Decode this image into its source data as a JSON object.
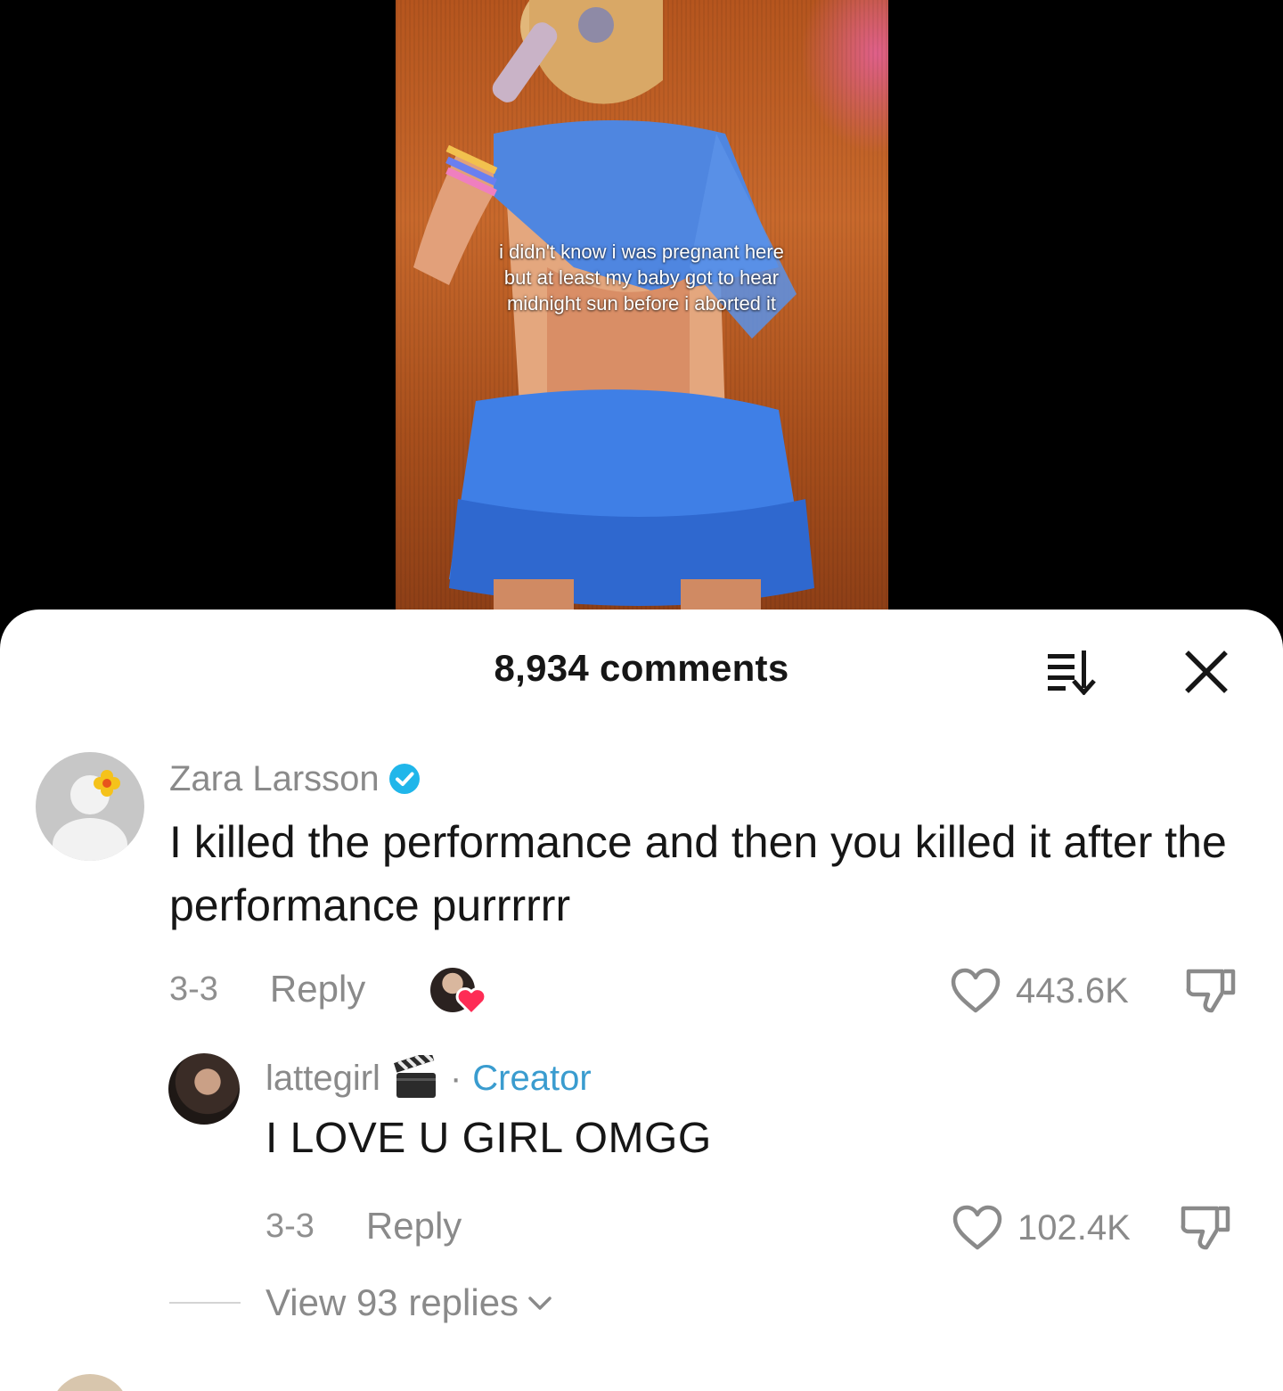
{
  "video": {
    "caption": "i didn't know i was pregnant here but at least my baby got to hear midnight sun before i aborted it"
  },
  "sheet": {
    "title": "8,934 comments"
  },
  "comment": {
    "author": "Zara Larsson",
    "text": "I killed the performance and then you killed it after the performance purrrrrr",
    "date": "3-3",
    "reply_label": "Reply",
    "likes": "443.6K"
  },
  "reply": {
    "author": "lattegirl",
    "separator": "·",
    "tag": "Creator",
    "text": "I LOVE U GIRL OMGG",
    "date": "3-3",
    "reply_label": "Reply",
    "likes": "102.4K"
  },
  "view_replies": {
    "label": "View 93 replies"
  },
  "colors": {
    "accent_creator": "#3a9ccf",
    "verified_badge": "#20b6ea",
    "liked_heart": "#fe2c55",
    "muted_text": "#8a8a8a",
    "primary_text": "#161616"
  },
  "icons": {
    "sort": "sort-icon",
    "close": "close-icon",
    "verified": "verified-badge-icon",
    "like": "heart-outline-icon",
    "dislike": "thumbs-down-icon",
    "creator_like": "creator-liked-heart-icon",
    "clapper": "clapperboard-emoji-icon",
    "chevron": "chevron-down-icon"
  }
}
